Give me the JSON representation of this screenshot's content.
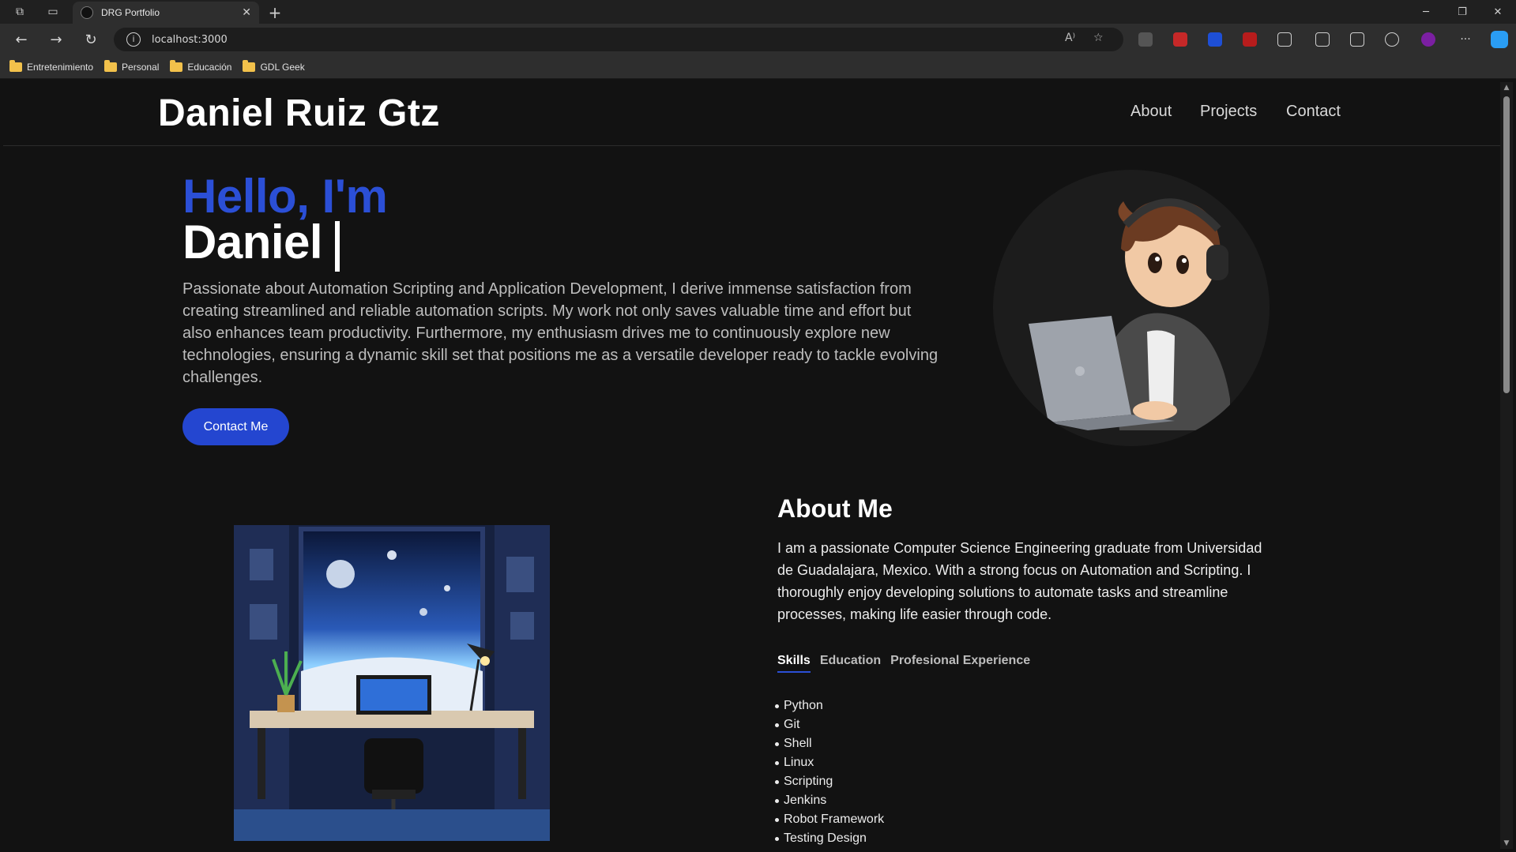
{
  "browser": {
    "tab_title": "DRG Portfolio",
    "url": "localhost:3000",
    "bookmarks": [
      "Entretenimiento",
      "Personal",
      "Educación",
      "GDL Geek"
    ]
  },
  "site": {
    "brand": "Daniel Ruiz Gtz",
    "nav": [
      "About",
      "Projects",
      "Contact"
    ]
  },
  "hero": {
    "greeting": "Hello, I'm",
    "name": "Daniel",
    "intro": "Passionate about Automation Scripting and Application Development, I derive immense satisfaction from creating streamlined and reliable automation scripts. My work not only saves valuable time and effort but also enhances team productivity. Furthermore, my enthusiasm drives me to continuously explore new technologies, ensuring a dynamic skill set that positions me as a versatile developer ready to tackle evolving challenges.",
    "cta": "Contact Me"
  },
  "about": {
    "title": "About Me",
    "text": "I am a passionate Computer Science Engineering graduate from Universidad de Guadalajara, Mexico. With a strong focus on Automation and Scripting. I thoroughly enjoy developing solutions to automate tasks and streamline processes, making life easier through code.",
    "tabs": [
      "Skills",
      "Education",
      "Profesional Experience"
    ],
    "skills": [
      "Python",
      "Git",
      "Shell",
      "Linux",
      "Scripting",
      "Jenkins",
      "Robot Framework",
      "Testing Design"
    ]
  },
  "colors": {
    "accent": "#2446d0",
    "background": "#121212"
  }
}
